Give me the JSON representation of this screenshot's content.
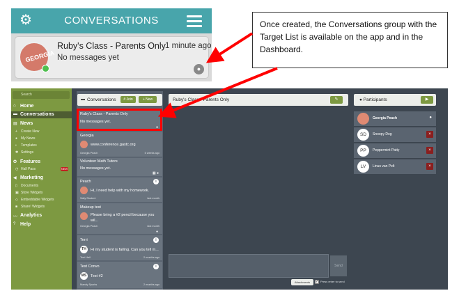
{
  "phone": {
    "title": "CONVERSATIONS",
    "group_name": "Ruby's Class - Parents Only",
    "time": "1 minute ago",
    "last_message": "No messages yet",
    "avatar_text": "GEORGIA"
  },
  "callout": {
    "text": "Once created, the Conversations group with the Target List is available on the app and in the Dashboard."
  },
  "sidebar": {
    "search_placeholder": "Search",
    "items": [
      {
        "label": "Home",
        "icon": "home-icon"
      },
      {
        "label": "Conversations",
        "icon": "chat-icon"
      },
      {
        "label": "News",
        "icon": "news-icon"
      },
      {
        "label": "Create New",
        "icon": "plus-icon"
      },
      {
        "label": "My News",
        "icon": "user-icon"
      },
      {
        "label": "Templates",
        "icon": "template-icon"
      },
      {
        "label": "Settings",
        "icon": "gear-icon"
      },
      {
        "label": "Features",
        "icon": "star-icon"
      },
      {
        "label": "Hall Pass",
        "icon": "clock-icon"
      },
      {
        "label": "Marketing",
        "icon": "megaphone-icon"
      },
      {
        "label": "Documents",
        "icon": "document-icon"
      },
      {
        "label": "Store Widgets",
        "icon": "store-icon"
      },
      {
        "label": "Embeddable Widgets",
        "icon": "embed-icon"
      },
      {
        "label": "Share! Widgets",
        "icon": "share-icon"
      },
      {
        "label": "Analytics",
        "icon": "chart-icon"
      },
      {
        "label": "Help",
        "icon": "help-icon"
      }
    ],
    "badge": "NEW"
  },
  "conversations": {
    "title": "Conversations",
    "join_label": "Join",
    "new_label": "New",
    "items": [
      {
        "title": "Ruby's Class - Parents Only",
        "message": "No messages yet."
      },
      {
        "title": "Georgia",
        "message": "www.conference.gastc.org",
        "meta": "Georgia Peach",
        "time": "5 weeks ago"
      },
      {
        "title": "Volunteer Math Tutors",
        "message": "No messages yet."
      },
      {
        "title": "Peach",
        "message": "Hi, I need help with my homework.",
        "meta": "Sally Student",
        "time": "last month"
      },
      {
        "title": "Makeup test",
        "message": "Please bring a #2 pencil because you wil...",
        "meta": "Georgia Peach",
        "time": "last month"
      },
      {
        "title": "Terri",
        "avatar": "TH",
        "message": "Hi my student is failing. Can you tell m...",
        "meta": "Terri Hall",
        "time": "2 months ago"
      },
      {
        "title": "Test Convo",
        "avatar": "MS",
        "message": "Test #2",
        "meta": "Mandy Sparks",
        "time": "2 months ago"
      }
    ]
  },
  "chat": {
    "title": "Ruby's Class - Parents Only",
    "send_label": "Send",
    "attachments_label": "Attachments",
    "enter_label": "Press enter to send"
  },
  "participants": {
    "title": "Participants",
    "items": [
      {
        "initials": "",
        "name": "Georgia Peach"
      },
      {
        "initials": "SD",
        "name": "Snoopy Dog"
      },
      {
        "initials": "PP",
        "name": "Peppermint Patty"
      },
      {
        "initials": "LV",
        "name": "Linus van Pelt"
      }
    ]
  },
  "colors": {
    "teal": "#48a5ab",
    "sidebar_green": "#7d9941",
    "dark_bg": "#3d4650",
    "highlight_red": "#ff0000"
  }
}
